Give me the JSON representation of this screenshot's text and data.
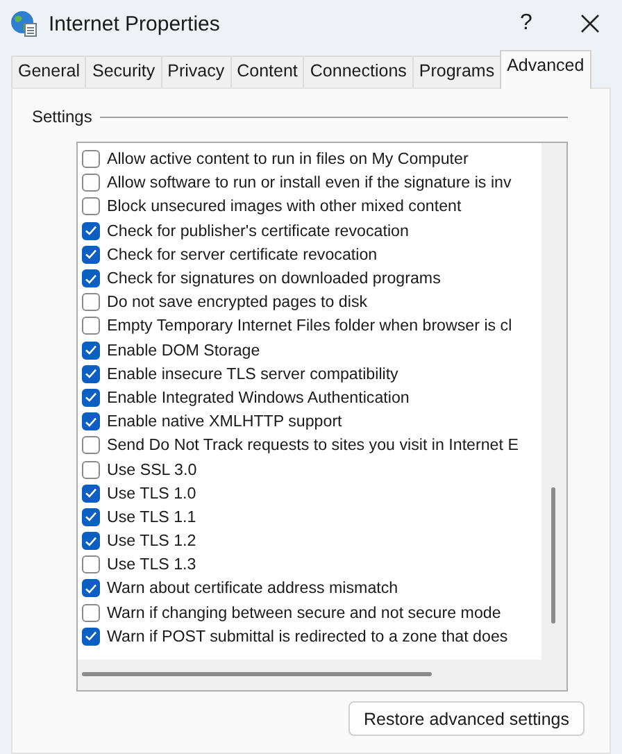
{
  "window": {
    "title": "Internet Properties",
    "help_button": "?"
  },
  "tabs": [
    {
      "label": "General",
      "selected": false
    },
    {
      "label": "Security",
      "selected": false
    },
    {
      "label": "Privacy",
      "selected": false
    },
    {
      "label": "Content",
      "selected": false
    },
    {
      "label": "Connections",
      "selected": false
    },
    {
      "label": "Programs",
      "selected": false
    },
    {
      "label": "Advanced",
      "selected": true
    }
  ],
  "settings": {
    "label": "Settings",
    "items": [
      {
        "label": "Allow active content to run in files on My Computer",
        "checked": false
      },
      {
        "label": "Allow software to run or install even if the signature is inv",
        "checked": false
      },
      {
        "label": "Block unsecured images with other mixed content",
        "checked": false
      },
      {
        "label": "Check for publisher's certificate revocation",
        "checked": true
      },
      {
        "label": "Check for server certificate revocation",
        "checked": true
      },
      {
        "label": "Check for signatures on downloaded programs",
        "checked": true
      },
      {
        "label": "Do not save encrypted pages to disk",
        "checked": false
      },
      {
        "label": "Empty Temporary Internet Files folder when browser is cl",
        "checked": false
      },
      {
        "label": "Enable DOM Storage",
        "checked": true
      },
      {
        "label": "Enable insecure TLS server compatibility",
        "checked": true
      },
      {
        "label": "Enable Integrated Windows Authentication",
        "checked": true
      },
      {
        "label": "Enable native XMLHTTP support",
        "checked": true
      },
      {
        "label": "Send Do Not Track requests to sites you visit in Internet E",
        "checked": false
      },
      {
        "label": "Use SSL 3.0",
        "checked": false
      },
      {
        "label": "Use TLS 1.0",
        "checked": true
      },
      {
        "label": "Use TLS 1.1",
        "checked": true
      },
      {
        "label": "Use TLS 1.2",
        "checked": true
      },
      {
        "label": "Use TLS 1.3",
        "checked": false
      },
      {
        "label": "Warn about certificate address mismatch",
        "checked": true
      },
      {
        "label": "Warn if changing between secure and not secure mode",
        "checked": false
      },
      {
        "label": "Warn if POST submittal is redirected to a zone that does",
        "checked": true
      }
    ]
  },
  "restore_button": "Restore advanced settings"
}
